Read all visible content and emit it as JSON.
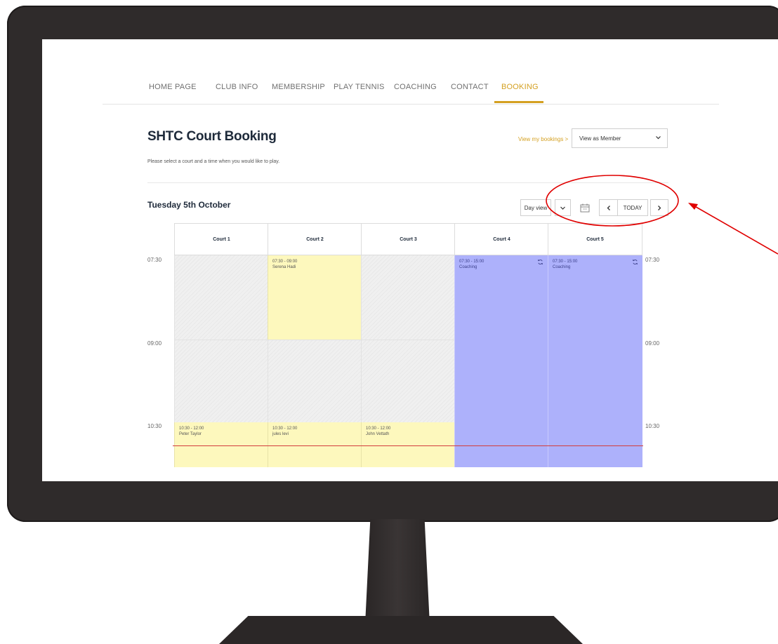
{
  "nav": {
    "items": [
      {
        "label": "HOME PAGE",
        "active": false
      },
      {
        "label": "CLUB INFO",
        "active": false
      },
      {
        "label": "MEMBERSHIP",
        "active": false
      },
      {
        "label": "PLAY TENNIS",
        "active": false
      },
      {
        "label": "COACHING",
        "active": false
      },
      {
        "label": "CONTACT",
        "active": false
      },
      {
        "label": "BOOKING",
        "active": true
      }
    ]
  },
  "header": {
    "title": "SHTC Court Booking",
    "subtitle": "Please select a court and a time when you would like to play.",
    "my_bookings_link": "View my bookings >",
    "view_as": {
      "selected": "View as Member",
      "icon": "chevron-down-icon"
    }
  },
  "toolbar": {
    "date": "Tuesday 5th October",
    "view_mode": "Day view",
    "today_label": "TODAY",
    "icons": [
      "chevron-down-icon",
      "calendar-icon",
      "chevron-left-icon",
      "chevron-right-icon"
    ]
  },
  "calendar": {
    "courts": [
      "Court 1",
      "Court 2",
      "Court 3",
      "Court 4",
      "Court 5"
    ],
    "times": [
      "07:30",
      "09:00",
      "10:30"
    ],
    "bookings": [
      {
        "court": "Court 2",
        "time": "07:30 - 09:00",
        "name": "Serena Hadi",
        "type": "member"
      },
      {
        "court": "Court 4",
        "time": "07:30 - 15:00",
        "name": "Coaching",
        "type": "coaching",
        "recurring": true
      },
      {
        "court": "Court 5",
        "time": "07:30 - 15:00",
        "name": "Coaching",
        "type": "coaching",
        "recurring": true
      },
      {
        "court": "Court 1",
        "time": "10:30 - 12:00",
        "name": "Peter Taylor",
        "type": "member"
      },
      {
        "court": "Court 2",
        "time": "10:30 - 12:00",
        "name": "jules levi",
        "type": "member"
      },
      {
        "court": "Court 3",
        "time": "10:30 - 12:00",
        "name": "John Vettath",
        "type": "member"
      }
    ]
  },
  "colors": {
    "accent": "#d4a021",
    "member_booking": "#fdf8bd",
    "coaching_booking": "#adb1fb",
    "current_time_line": "#d23c3c",
    "annotation": "#e00000"
  }
}
